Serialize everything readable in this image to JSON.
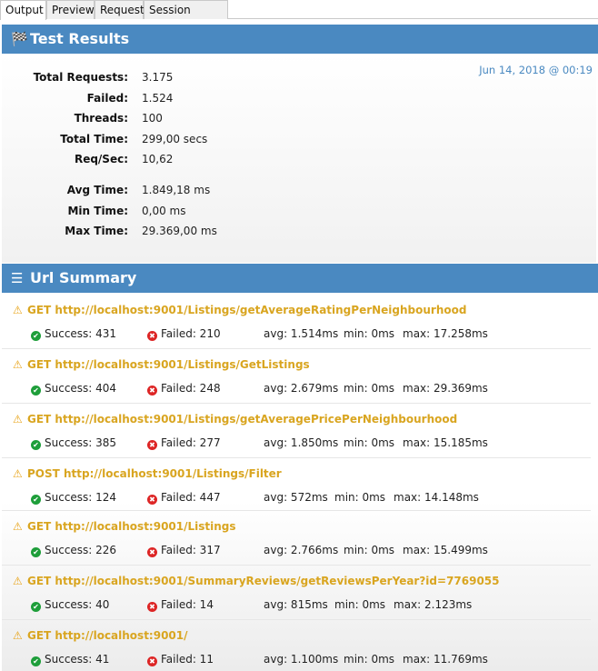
{
  "tabs": [
    {
      "label": "Output",
      "active": true
    },
    {
      "label": "Preview",
      "active": false
    },
    {
      "label": "Request",
      "active": false
    },
    {
      "label": "Session Options",
      "active": false
    }
  ],
  "colors": {
    "header": "#4a89c1",
    "url": "#d9a520",
    "success": "#1e9e3a",
    "failed": "#dd2525",
    "timestamp": "#4a89c1"
  },
  "results": {
    "title": "Test Results",
    "icon": "checkered-flag-icon",
    "timestamp": "Jun 14, 2018 @ 00:19",
    "stats": [
      {
        "label": "Total Requests:",
        "value": "3.175"
      },
      {
        "label": "Failed:",
        "value": "1.524"
      },
      {
        "label": "Threads:",
        "value": "100"
      },
      {
        "label": "Total Time:",
        "value": "299,00 secs"
      },
      {
        "label": "Req/Sec:",
        "value": "10,62"
      },
      {
        "label": "Avg Time:",
        "value": "1.849,18 ms"
      },
      {
        "label": "Min Time:",
        "value": "0,00 ms"
      },
      {
        "label": "Max Time:",
        "value": "29.369,00 ms"
      }
    ]
  },
  "summary": {
    "title": "Url Summary",
    "icon": "list-icon",
    "urls": [
      {
        "title": "GET http://localhost:9001/Listings/getAverageRatingPerNeighbourhood",
        "success": "Success: 431",
        "failed": "Failed: 210",
        "avg": "avg: 1.514ms",
        "min": "min: 0ms",
        "max": "max: 17.258ms"
      },
      {
        "title": "GET http://localhost:9001/Listings/GetListings",
        "success": "Success: 404",
        "failed": "Failed: 248",
        "avg": "avg: 2.679ms",
        "min": "min: 0ms",
        "max": "max: 29.369ms"
      },
      {
        "title": "GET http://localhost:9001/Listings/getAveragePricePerNeighbourhood",
        "success": "Success: 385",
        "failed": "Failed: 277",
        "avg": "avg: 1.850ms",
        "min": "min: 0ms",
        "max": "max: 15.185ms"
      },
      {
        "title": "POST http://localhost:9001/Listings/Filter",
        "success": "Success: 124",
        "failed": "Failed: 447",
        "avg": "avg: 572ms",
        "min": "min: 0ms",
        "max": "max: 14.148ms"
      },
      {
        "title": "GET http://localhost:9001/Listings",
        "success": "Success: 226",
        "failed": "Failed: 317",
        "avg": "avg: 2.766ms",
        "min": "min: 0ms",
        "max": "max: 15.499ms"
      },
      {
        "title": "GET http://localhost:9001/SummaryReviews/getReviewsPerYear?id=7769055",
        "success": "Success: 40",
        "failed": "Failed: 14",
        "avg": "avg: 815ms",
        "min": "min: 0ms",
        "max": "max: 2.123ms"
      },
      {
        "title": "GET http://localhost:9001/",
        "success": "Success: 41",
        "failed": "Failed: 11",
        "avg": "avg: 1.100ms",
        "min": "min: 0ms",
        "max": "max: 11.769ms"
      }
    ]
  }
}
